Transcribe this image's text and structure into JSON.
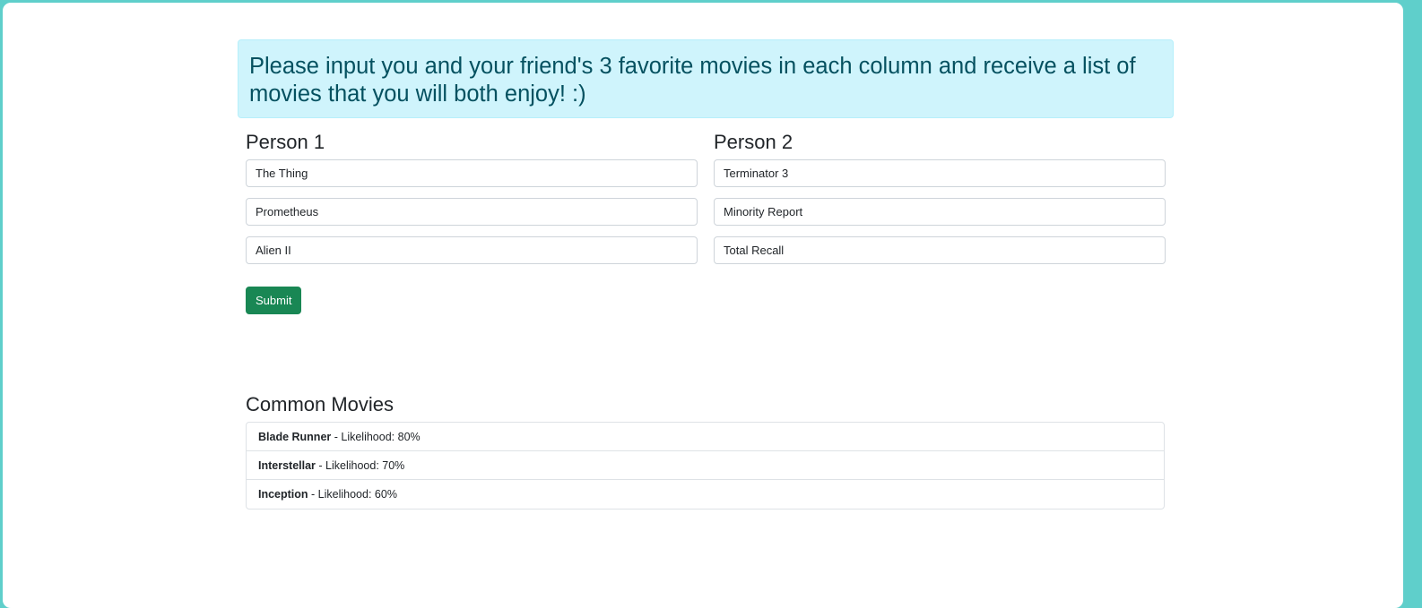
{
  "header": {
    "instructions": "Please input you and your friend's 3 favorite movies in each column and receive a list of movies that you will both enjoy! :)"
  },
  "person1": {
    "title": "Person 1",
    "movies": [
      "The Thing",
      "Prometheus",
      "Alien II"
    ]
  },
  "person2": {
    "title": "Person 2",
    "movies": [
      "Terminator 3",
      "Minority Report",
      "Total Recall"
    ]
  },
  "form": {
    "submit_label": "Submit"
  },
  "results": {
    "title": "Common Movies",
    "items": [
      {
        "title": "Blade Runner",
        "detail": " - Likelihood: 80%"
      },
      {
        "title": "Interstellar",
        "detail": " - Likelihood: 70%"
      },
      {
        "title": "Inception",
        "detail": " - Likelihood: 60%"
      }
    ]
  },
  "colors": {
    "page_border": "#5fcfcb",
    "alert_bg": "#cff4fc",
    "alert_text": "#055160",
    "submit_bg": "#198754"
  }
}
